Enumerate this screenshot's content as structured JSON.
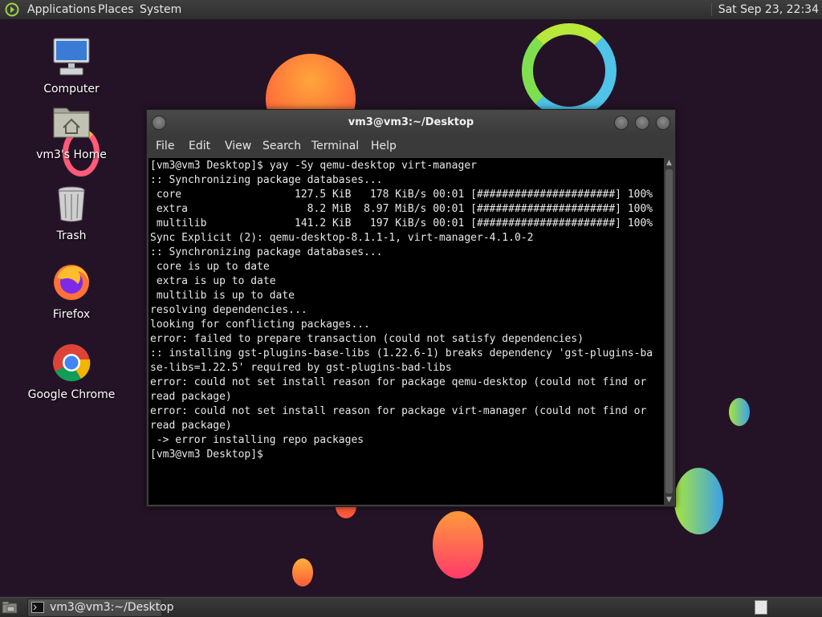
{
  "top_panel": {
    "menus": [
      "Applications",
      "Places",
      "System"
    ],
    "clock": "Sat Sep 23, 22:34"
  },
  "desktop_icons": [
    "Computer",
    "vm3's Home",
    "Trash",
    "Firefox",
    "Google Chrome"
  ],
  "window": {
    "title": "vm3@vm3:~/Desktop",
    "menus": [
      "File",
      "Edit",
      "View",
      "Search",
      "Terminal",
      "Help"
    ],
    "terminal_lines": [
      "[vm3@vm3 Desktop]$ yay -Sy qemu-desktop virt-manager",
      ":: Synchronizing package databases...",
      " core                  127.5 KiB   178 KiB/s 00:01 [######################] 100%",
      " extra                   8.2 MiB  8.97 MiB/s 00:01 [######################] 100%",
      " multilib              141.2 KiB   197 KiB/s 00:01 [######################] 100%",
      "Sync Explicit (2): qemu-desktop-8.1.1-1, virt-manager-4.1.0-2",
      ":: Synchronizing package databases...",
      " core is up to date",
      " extra is up to date",
      " multilib is up to date",
      "resolving dependencies...",
      "looking for conflicting packages...",
      "error: failed to prepare transaction (could not satisfy dependencies)",
      ":: installing gst-plugins-base-libs (1.22.6-1) breaks dependency 'gst-plugins-ba",
      "se-libs=1.22.5' required by gst-plugins-bad-libs",
      "error: could not set install reason for package qemu-desktop (could not find or",
      "read package)",
      "error: could not set install reason for package virt-manager (could not find or",
      "read package)",
      " -> error installing repo packages",
      "[vm3@vm3 Desktop]$"
    ]
  },
  "taskbar": {
    "task_label": "vm3@vm3:~/Desktop"
  },
  "colors": {
    "background": "#241326",
    "panel": "#333333",
    "terminal_bg": "#000000",
    "terminal_fg": "#e8e8e8"
  }
}
